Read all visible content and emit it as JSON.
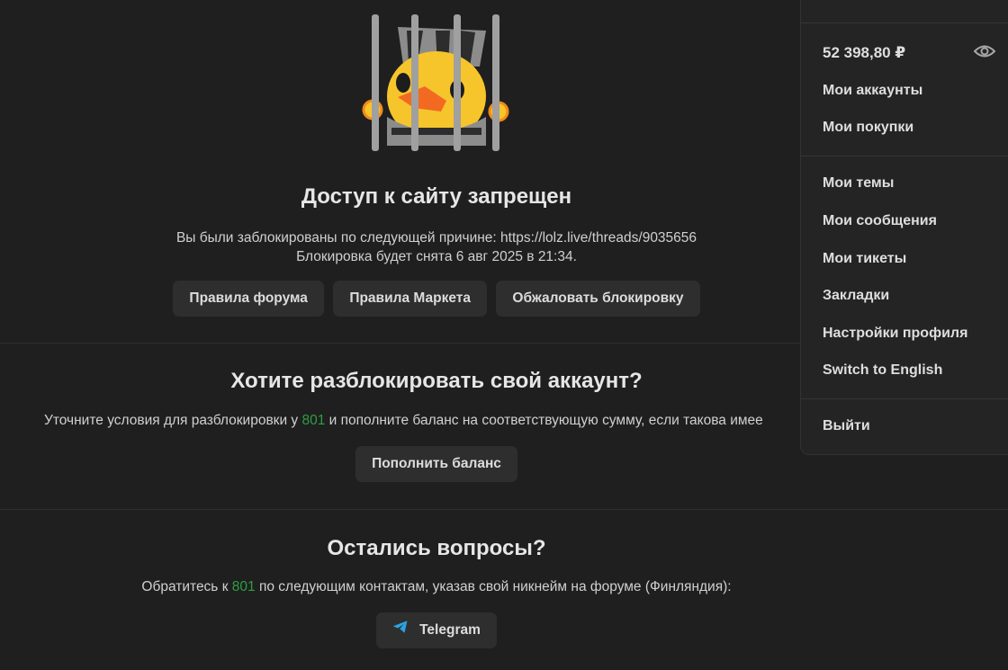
{
  "ban": {
    "title": "Доступ к сайту запрещен",
    "reason_line": "Вы были заблокированы по следующей причине: https://lolz.live/threads/9035656",
    "unban_line": "Блокировка будет снята 6 авг 2025 в 21:34.",
    "buttons": [
      "Правила форума",
      "Правила Маркета",
      "Обжаловать блокировку"
    ]
  },
  "unlock": {
    "title": "Хотите разблокировать свой аккаунт?",
    "text_before": "Уточните условия для разблокировки у ",
    "highlight": "801",
    "text_after": " и пополните баланс на соответствующую сумму, если такова имее",
    "button": "Пополнить баланс"
  },
  "questions": {
    "title": "Остались вопросы?",
    "text_before": "Обратитесь к ",
    "highlight": "801",
    "text_after": " по следующим контактам, указав свой никнейм на форуме (Финляндия):",
    "telegram_button": "Telegram"
  },
  "menu": {
    "balance": "52 398,80 ₽",
    "items": [
      "Мои аккаунты",
      "Мои покупки",
      "Мои темы",
      "Мои сообщения",
      "Мои тикеты",
      "Закладки",
      "Настройки профиля",
      "Switch to English",
      "Выйти"
    ]
  },
  "colors": {
    "accent_green": "#2f9e44",
    "telegram_blue": "#2aa3e0",
    "background": "#1f1f1f"
  },
  "icons": {
    "mascot": "jailed-duck-mascot",
    "eye": "eye-icon",
    "telegram": "telegram-icon"
  }
}
